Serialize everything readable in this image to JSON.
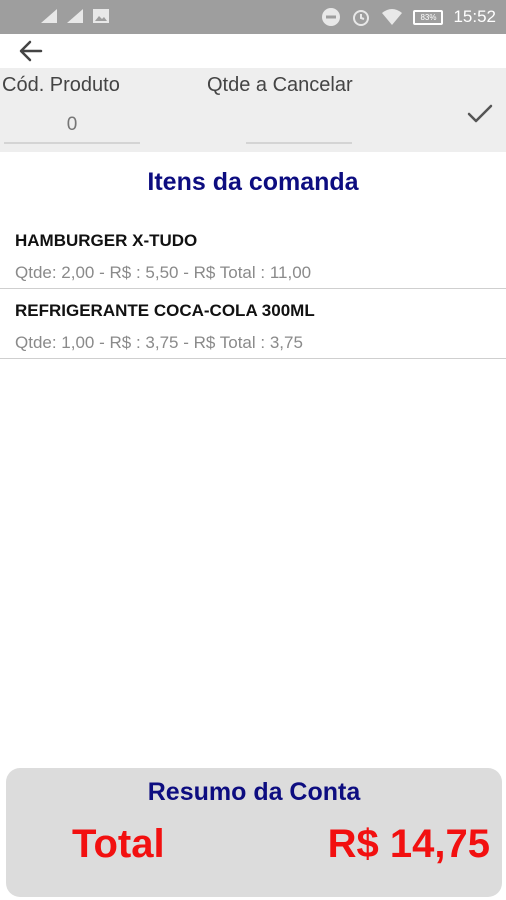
{
  "status_bar": {
    "time": "15:52",
    "battery": "83%",
    "icons": [
      "signal-icon",
      "signal-icon",
      "image-icon",
      "do-not-disturb-icon",
      "alarm-icon",
      "wifi-icon",
      "battery-icon"
    ]
  },
  "appbar": {
    "back_icon": "arrow-left-icon"
  },
  "form": {
    "cod_label": "Cód. Produto",
    "qtde_label": "Qtde a Cancelar",
    "cod_placeholder": "0",
    "qtde_value": "",
    "confirm_icon": "check-icon"
  },
  "list": {
    "title": "Itens da comanda",
    "items": [
      {
        "name": "HAMBURGER X-TUDO",
        "detail": "Qtde: 2,00 - R$ : 5,50 - R$ Total : 11,00"
      },
      {
        "name": "REFRIGERANTE COCA-COLA 300ML",
        "detail": "Qtde: 1,00 - R$ : 3,75 - R$ Total : 3,75"
      }
    ]
  },
  "summary": {
    "title": "Resumo da Conta",
    "total_label": "Total",
    "total_value": "R$ 14,75"
  },
  "colors": {
    "accent_blue": "#0d0d80",
    "total_red": "#f21010",
    "status_bar": "#9e9e9e"
  }
}
